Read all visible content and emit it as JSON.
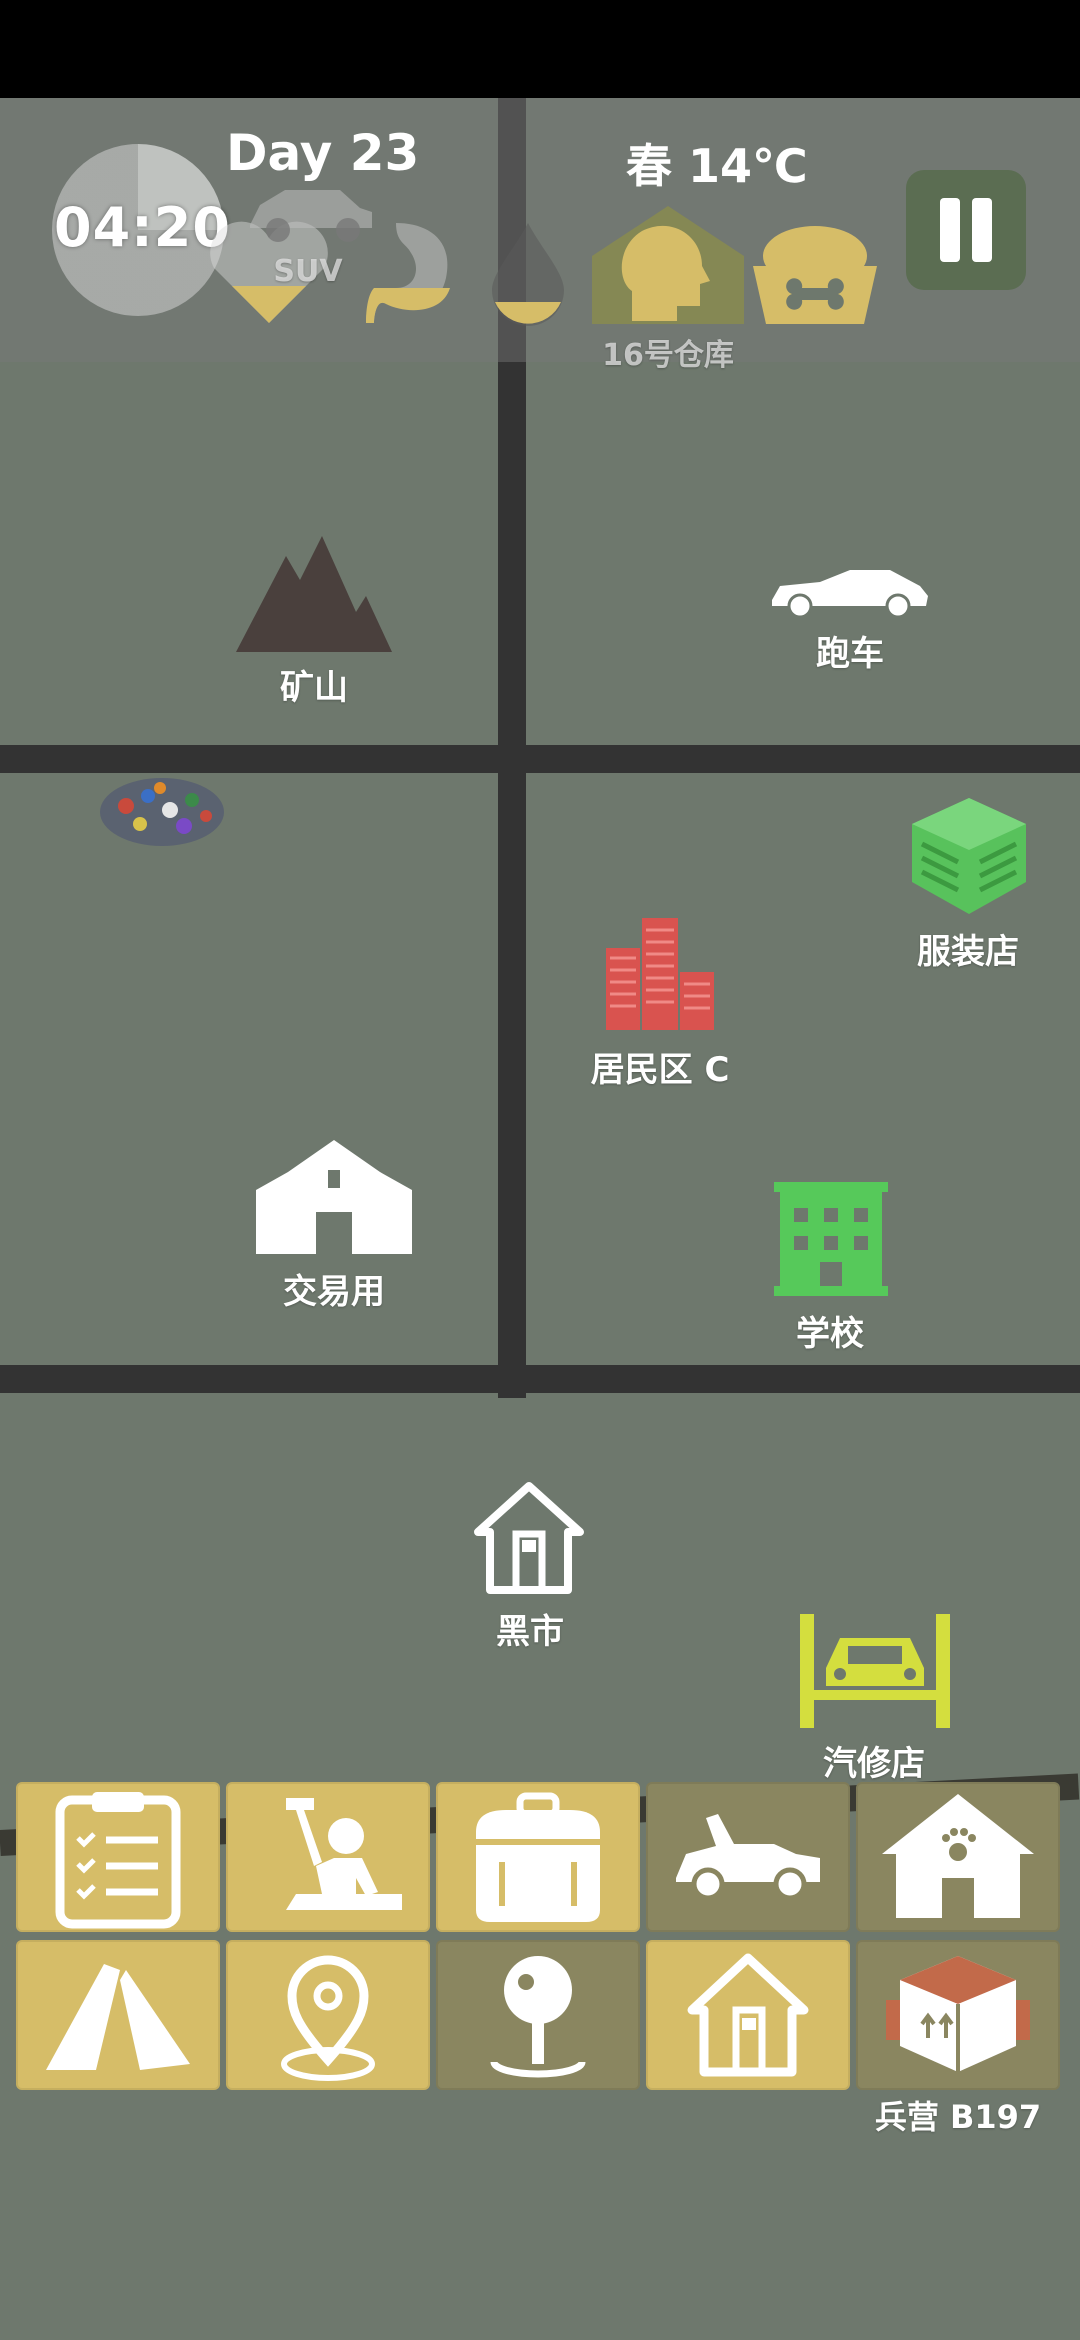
{
  "hud": {
    "clock": "04:20",
    "day": "Day 23",
    "season_temp": "春 14℃",
    "vehicle": "SUV",
    "home_base": "16号仓库"
  },
  "map": {
    "locations": {
      "mine": "矿山",
      "sports_car": "跑车",
      "clothing_store": "服装店",
      "residential": "居民区 C",
      "trade": "交易用",
      "school": "学校",
      "black_market": "黑市",
      "garage": "汽修店",
      "barracks": "兵营 B197"
    }
  },
  "colors": {
    "background": "#6e786d",
    "road": "#333333",
    "button_gold": "#d6bd68",
    "button_dim": "#8a8660",
    "school_green": "#56c95a",
    "clothing_green": "#58c25c",
    "residential_red": "#d9534f",
    "garage_yellow": "#d4de3e",
    "mountain_brown": "#4a403d"
  },
  "action_buttons": [
    {
      "icon": "clipboard-checklist-icon",
      "enabled": true
    },
    {
      "icon": "crafting-hammer-icon",
      "enabled": true
    },
    {
      "icon": "backpack-icon",
      "enabled": true
    },
    {
      "icon": "car-trunk-icon",
      "enabled": false
    },
    {
      "icon": "pet-house-icon",
      "enabled": true
    },
    {
      "icon": "tent-icon",
      "enabled": true
    },
    {
      "icon": "location-pin-icon",
      "enabled": true
    },
    {
      "icon": "map-pin-stand-icon",
      "enabled": false
    },
    {
      "icon": "home-icon",
      "enabled": true
    },
    {
      "icon": "supply-box-icon",
      "enabled": false
    }
  ]
}
